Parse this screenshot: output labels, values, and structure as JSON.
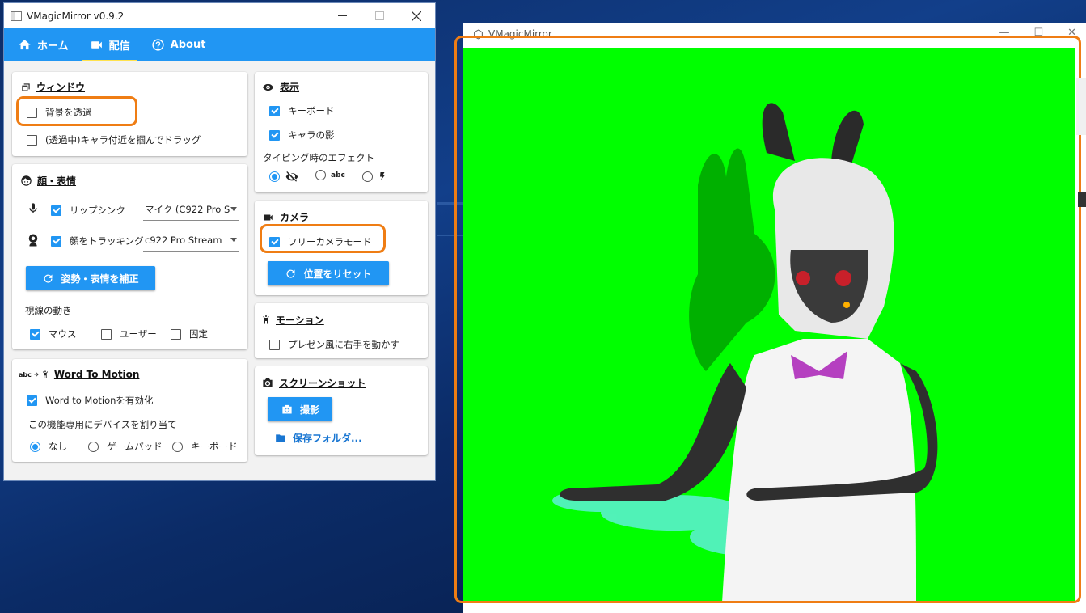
{
  "control_window": {
    "title": "VMagicMirror v0.9.2",
    "controls": {
      "minimize": "—",
      "maximize": "☐",
      "close": "✕"
    }
  },
  "nav": {
    "tabs": [
      {
        "label": "ホーム",
        "icon": "home-icon",
        "active": false
      },
      {
        "label": "配信",
        "icon": "video-camera-icon",
        "active": true
      },
      {
        "label": "About",
        "icon": "help-circle-icon",
        "active": false
      }
    ]
  },
  "window_card": {
    "title": "ウィンドウ",
    "icon": "window-restore-icon",
    "transparent_bg_label": "背景を透過",
    "transparent_bg_checked": false,
    "drag_label": "(透過中)キャラ付近を掴んでドラッグ",
    "drag_checked": false
  },
  "face_card": {
    "title": "顔・表情",
    "icon": "face-icon",
    "lipsync_label": "リップシンク",
    "lipsync_checked": true,
    "mic_select_value": "マイク (C922 Pro S",
    "face_track_label": "顔をトラッキング",
    "face_track_checked": true,
    "camera_select_value": "c922 Pro Stream",
    "calibrate_button": "姿勢・表情を補正",
    "gaze_label": "視線の動き",
    "gaze_options": [
      {
        "label": "マウス",
        "checked": true
      },
      {
        "label": "ユーザー",
        "checked": false
      },
      {
        "label": "固定",
        "checked": false
      }
    ]
  },
  "wtm_card": {
    "title": "Word To Motion",
    "icon_text": "abc",
    "enable_label": "Word to Motionを有効化",
    "enable_checked": true,
    "device_label": "この機能専用にデバイスを割り当て",
    "device_options": [
      {
        "label": "なし",
        "selected": true
      },
      {
        "label": "ゲームパッド",
        "selected": false
      },
      {
        "label": "キーボード",
        "selected": false
      }
    ]
  },
  "display_card": {
    "title": "表示",
    "icon": "eye-icon",
    "keyboard_label": "キーボード",
    "keyboard_checked": true,
    "shadow_label": "キャラの影",
    "shadow_checked": true,
    "typing_effect_label": "タイピング時のエフェクト",
    "typing_effect_options": [
      {
        "icon": "eye-off-icon",
        "selected": true
      },
      {
        "icon_text": "abc",
        "selected": false
      },
      {
        "icon": "lightning-icon",
        "selected": false
      }
    ]
  },
  "camera_card": {
    "title": "カメラ",
    "icon": "video-camera-icon",
    "free_camera_label": "フリーカメラモード",
    "free_camera_checked": true,
    "reset_button": "位置をリセット"
  },
  "motion_card": {
    "title": "モーション",
    "icon": "person-icon",
    "presen_label": "プレゼン風に右手を動かす",
    "presen_checked": false
  },
  "screenshot_card": {
    "title": "スクリーンショット",
    "icon": "camera-icon",
    "shoot_button": "撮影",
    "folder_link": "保存フォルダ..."
  },
  "avatar_window": {
    "title": "VMagicMirror",
    "background_color": "#00ff00"
  },
  "colors": {
    "accent": "#2196f3",
    "highlight": "#ef7d14",
    "chroma_green": "#00ff00"
  }
}
